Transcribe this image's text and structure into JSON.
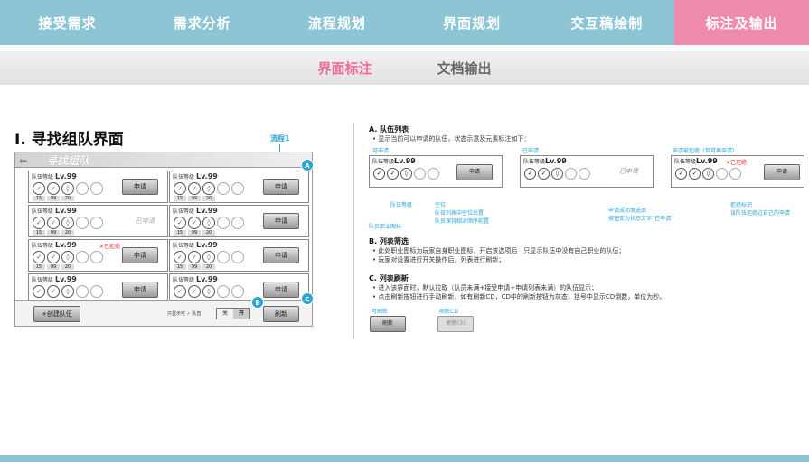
{
  "nav": {
    "tabs": [
      "接受需求",
      "需求分析",
      "流程规划",
      "界面规划",
      "交互稿绘制",
      "标注及输出"
    ],
    "active_index": 5
  },
  "subnav": {
    "items": [
      "界面标注",
      "文档输出"
    ],
    "active_index": 0
  },
  "heading": "I. 寻找组队界面",
  "flow_label": "流程1",
  "mock": {
    "title": "寻找组队",
    "team_label": "队伍等级",
    "level": "Lv.99",
    "stat_nums": [
      "15",
      "99",
      "20"
    ],
    "apply_label": "申请",
    "applied_label": "已申请",
    "rejected_label": "已拒绝",
    "create_label": "+创建队伍",
    "only_show_label": "只显示可",
    "team_text": "队伍",
    "toggle_off": "关",
    "toggle_on": "开",
    "refresh_label": "刷新",
    "badges": [
      "A",
      "B",
      "C"
    ]
  },
  "right": {
    "secA_title": "A. 队伍列表",
    "secA_bullet": "显示当前可以申请的队伍，状态示意及元素标注如下：",
    "state_apply": "可申请",
    "state_applied": "已申请",
    "state_rejected": "申请被拒绝（但可再申请）",
    "anno_job": "队员职业图标",
    "anno_level": "队伍等级",
    "anno_vacancy": "空位",
    "anno_vacancy2": "队伍列表中空位后置",
    "anno_vacancy3": "队员保持相对顺序前置",
    "anno_success": "申请成功发送后",
    "anno_success2": "按钮变为状态文字“已申请”",
    "anno_reject": "拒绝标识",
    "anno_reject2": "该队伍拒绝过自己的申请",
    "secB_title": "B. 列表筛选",
    "secB_bullet1": "此处职业图标为玩家自身职业图标，开启该选项后　只显示队伍中没有自己职业的队伍；",
    "secB_bullet2": "玩家对设置进行开关操作后，列表进行刷新；",
    "secC_title": "C. 列表刷新",
    "secC_bullet1": "进入该界面时，默认拉取（队员未满+接受申请+申请列表未满）的队伍显示；",
    "secC_bullet2": "点击刷新按钮进行手动刷新，如有刷新CD，CD中的刷新按钮为灰态，括号中显示CD倒数，单位为秒。",
    "refresh_ok_label": "可刷新",
    "refresh_cd_label": "刷新CD",
    "refresh_btn": "刷新",
    "refresh_cd_btn": "刷新(3)"
  },
  "colors": {
    "nav_blue": "#8ec5d4",
    "nav_pink": "#f08cab",
    "anno_blue": "#2aa6d6",
    "reject_red": "#d33333"
  }
}
